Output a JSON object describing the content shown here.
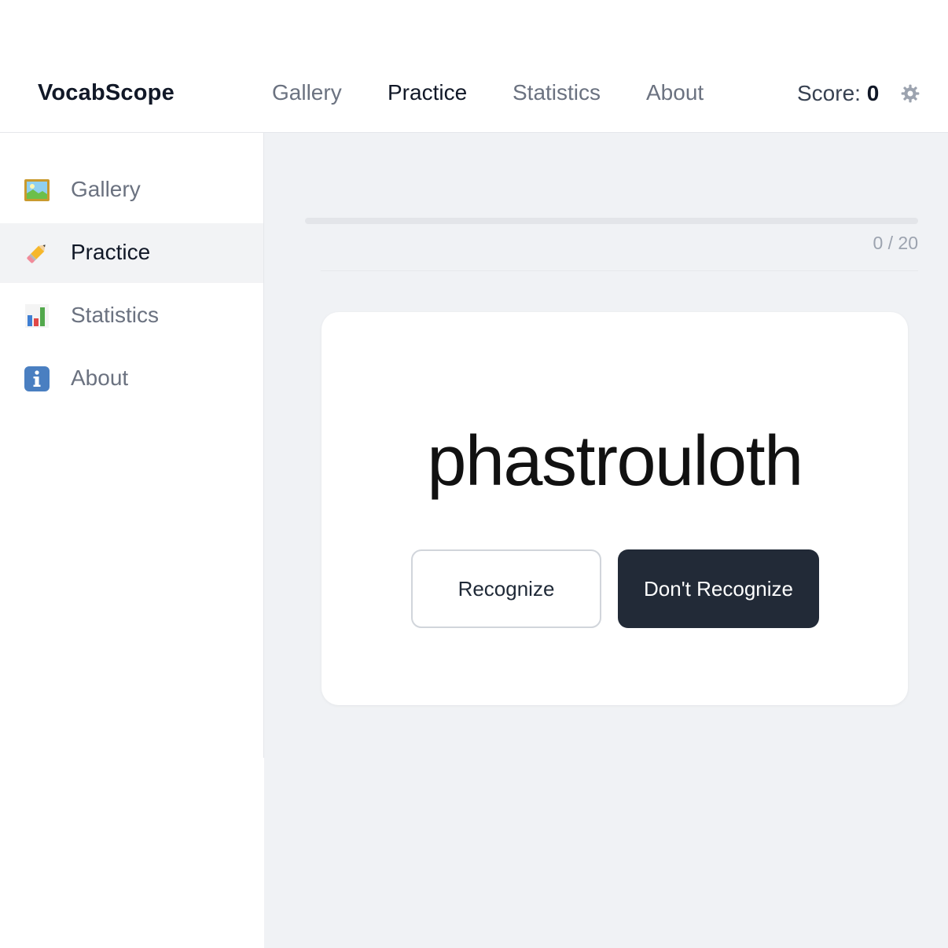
{
  "app": {
    "name": "VocabScope"
  },
  "topnav": {
    "items": [
      {
        "label": "Gallery",
        "active": false
      },
      {
        "label": "Practice",
        "active": true
      },
      {
        "label": "Statistics",
        "active": false
      },
      {
        "label": "About",
        "active": false
      }
    ]
  },
  "score": {
    "label": "Score:",
    "value": "0"
  },
  "header_icons": {
    "settings": "gear-icon"
  },
  "sidebar": {
    "items": [
      {
        "label": "Gallery",
        "icon": "framed-picture-icon",
        "active": false
      },
      {
        "label": "Practice",
        "icon": "pencil-icon",
        "active": true
      },
      {
        "label": "Statistics",
        "icon": "bar-chart-icon",
        "active": false
      },
      {
        "label": "About",
        "icon": "info-icon",
        "active": false
      }
    ]
  },
  "progress": {
    "text": "0 / 20",
    "current": 0,
    "total": 20,
    "fraction": 0
  },
  "card": {
    "word": "phastrouloth",
    "recognize_label": "Recognize",
    "dont_recognize_label": "Don't Recognize"
  },
  "colors": {
    "accent_dark": "#222a37",
    "main_background": "#f0f2f5",
    "active_sidebar_bg": "#f2f3f5",
    "muted_text": "#6b7280"
  }
}
